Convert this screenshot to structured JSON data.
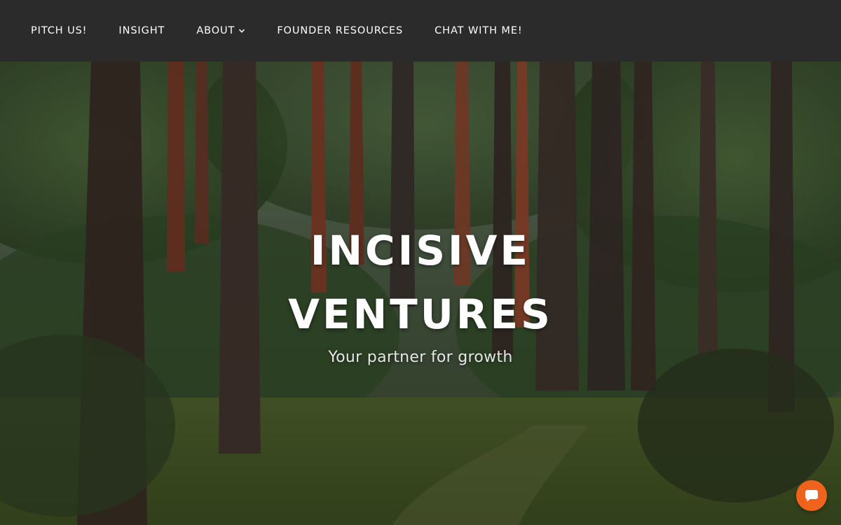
{
  "nav": {
    "items": [
      {
        "label": "PITCH US!"
      },
      {
        "label": "INSIGHT"
      },
      {
        "label": "ABOUT",
        "has_dropdown": true
      },
      {
        "label": "FOUNDER RESOURCES"
      },
      {
        "label": "CHAT WITH ME!"
      }
    ]
  },
  "hero": {
    "title_line1": "INCISIVE",
    "title_line2": "VENTURES",
    "subtitle": "Your partner for growth",
    "background_image": "forest-path-with-pine-trees"
  },
  "chat_widget": {
    "icon": "chat-bubble-icon",
    "color": "#f0631c"
  },
  "colors": {
    "nav_background": "#2b2b2b",
    "nav_text": "#ffffff",
    "hero_text": "#ffffff"
  }
}
